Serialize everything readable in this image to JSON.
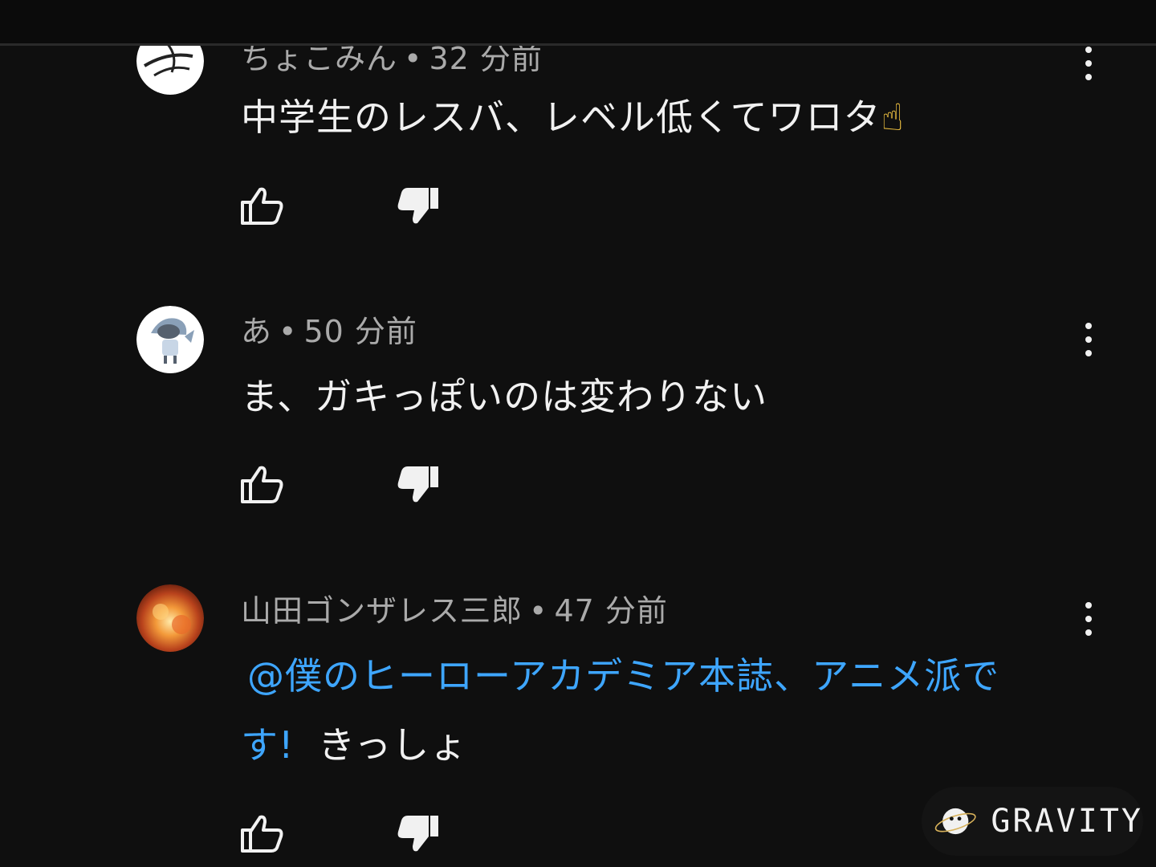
{
  "comments": [
    {
      "author": "ちょこみん",
      "time": "32 分前",
      "text": "中学生のレスバ、レベル低くてワロタ",
      "emoji": "☝"
    },
    {
      "author": "あ",
      "time": "50 分前",
      "text": "ま、ガキっぽいのは変わりない"
    },
    {
      "author": "山田ゴンザレス三郎",
      "time": "47 分前",
      "mention_line1": "@僕のヒーローアカデミア本誌、アニメ派で",
      "mention_line2": "す!",
      "text_after": "きっしょ"
    }
  ],
  "separator": "•",
  "watermark": {
    "label": "GRAVITY"
  },
  "colors": {
    "background": "#0f0f0f",
    "text_primary": "#f1f1f1",
    "text_secondary": "#aaaaaa",
    "mention": "#3ea6ff"
  },
  "icons": {
    "like": "thumbs-up-icon",
    "dislike": "thumbs-down-filled-icon",
    "menu": "vertical-dots-icon"
  }
}
